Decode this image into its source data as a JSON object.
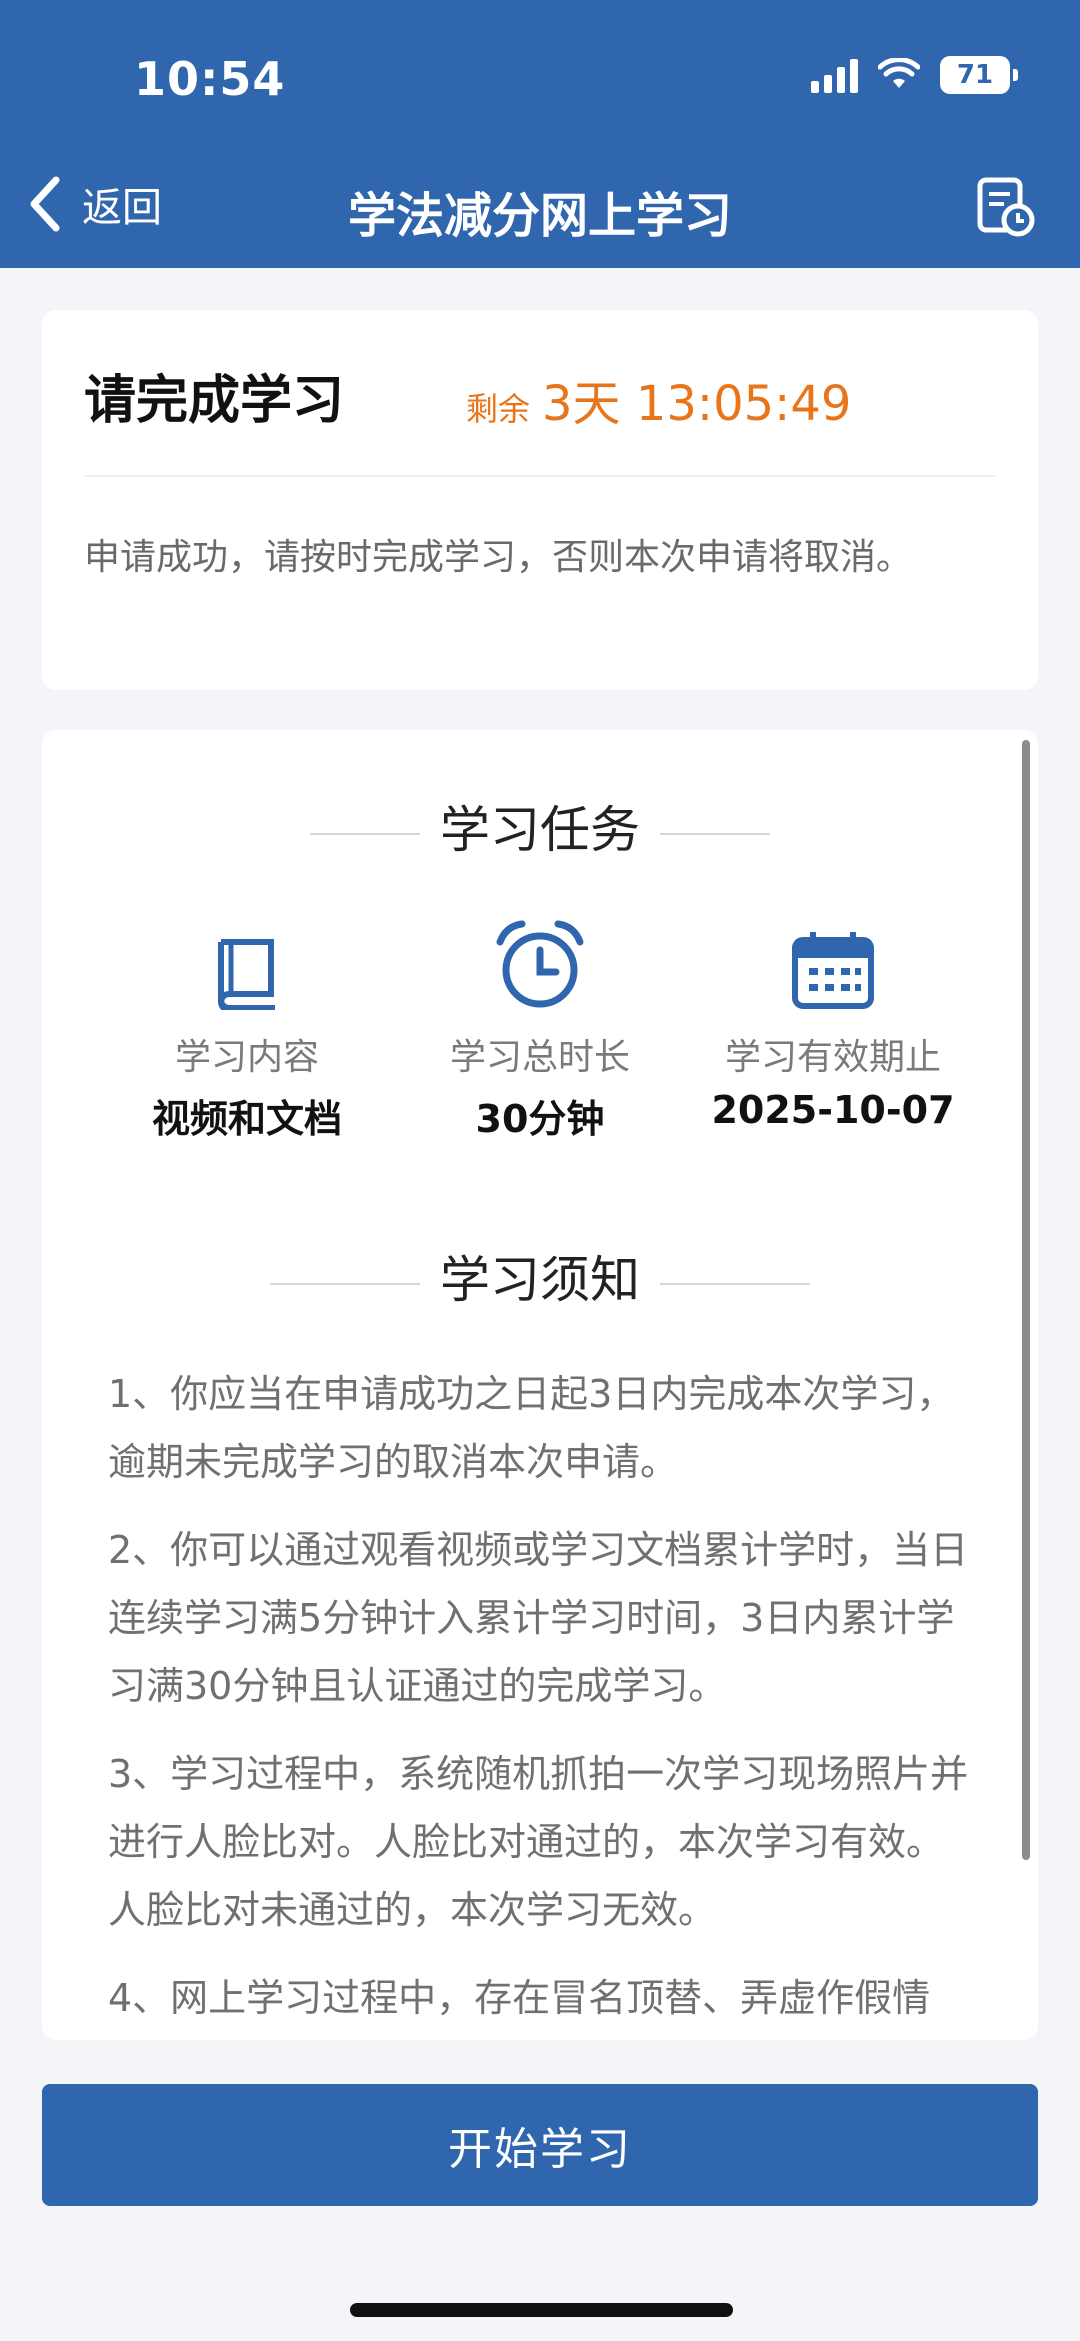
{
  "status_bar": {
    "time": "10:54",
    "battery": "71"
  },
  "nav": {
    "back_label": "返回",
    "title": "学法减分网上学习"
  },
  "countdown_card": {
    "title": "请完成学习",
    "remaining_label": "剩余",
    "remaining_value": "3天 13:05:49",
    "notice": "申请成功，请按时完成学习，否则本次申请将取消。"
  },
  "task_section": {
    "title": "学习任务",
    "items": [
      {
        "icon": "book-icon",
        "label": "学习内容",
        "value": "视频和文档"
      },
      {
        "icon": "alarm-clock-icon",
        "label": "学习总时长",
        "value": "30分钟"
      },
      {
        "icon": "calendar-icon",
        "label": "学习有效期止",
        "value": "2025-10-07"
      }
    ]
  },
  "rules_section": {
    "title": "学习须知",
    "rules": [
      "1、你应当在申请成功之日起3日内完成本次学习，逾期未完成学习的取消本次申请。",
      "2、你可以通过观看视频或学习文档累计学时，当日连续学习满5分钟计入累计学习时间，3日内累计学习满30分钟且认证通过的完成学习。",
      "3、学习过程中，系统随机抓拍一次学习现场照片并进行人脸比对。人脸比对通过的，本次学习有效。人脸比对未通过的，本次学习无效。",
      "4、网上学习过程中，存在冒名顶替、弄虚作假情"
    ]
  },
  "start_button": {
    "label": "开始学习"
  },
  "colors": {
    "primary": "#2f66ad",
    "accent": "#e8751a",
    "background": "#f3f5f8"
  }
}
